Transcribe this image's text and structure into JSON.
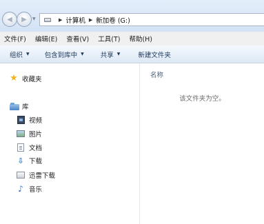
{
  "address_bar": {
    "crumbs": [
      "计算机",
      "新加卷 (G:)"
    ]
  },
  "menu": [
    "文件(F)",
    "编辑(E)",
    "查看(V)",
    "工具(T)",
    "帮助(H)"
  ],
  "toolbar": {
    "organize": "组织",
    "include_in_library": "包含到库中",
    "share": "共享",
    "new_folder": "新建文件夹"
  },
  "nav": {
    "favorites": "收藏夹",
    "libraries": "库",
    "videos": "视频",
    "pictures": "图片",
    "documents": "文档",
    "downloads": "下载",
    "thunder_downloads": "迅雷下载",
    "music": "音乐"
  },
  "content": {
    "column_name": "名称",
    "empty_message": "该文件夹为空。"
  },
  "icons": {
    "favorites": "star-icon",
    "libraries": "library-icon",
    "videos": "video-library-icon",
    "pictures": "picture-library-icon",
    "documents": "document-library-icon",
    "downloads": "download-icon",
    "thunder_downloads": "thunder-download-icon",
    "music": "music-icon"
  }
}
